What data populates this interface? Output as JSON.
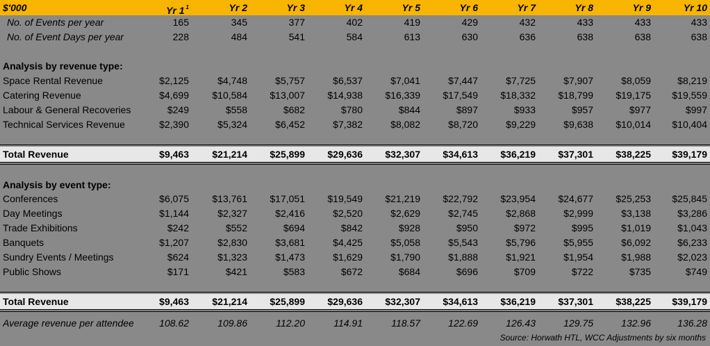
{
  "header": {
    "unit": "$'000",
    "years": [
      "Yr 1",
      "Yr 2",
      "Yr 3",
      "Yr 4",
      "Yr 5",
      "Yr 6",
      "Yr 7",
      "Yr 8",
      "Yr 9",
      "Yr 10"
    ],
    "yr1_footnote": "1"
  },
  "events": [
    {
      "label": "No. of  Events per year",
      "values": [
        "165",
        "345",
        "377",
        "402",
        "419",
        "429",
        "432",
        "433",
        "433",
        "433"
      ]
    },
    {
      "label": "No. of Event Days per year",
      "values": [
        "228",
        "484",
        "541",
        "584",
        "613",
        "630",
        "636",
        "638",
        "638",
        "638"
      ]
    }
  ],
  "revenue_section": {
    "title": "Analysis by revenue type:",
    "rows": [
      {
        "label": "Space Rental Revenue",
        "values": [
          "$2,125",
          "$4,748",
          "$5,757",
          "$6,537",
          "$7,041",
          "$7,447",
          "$7,725",
          "$7,907",
          "$8,059",
          "$8,219"
        ]
      },
      {
        "label": "Catering Revenue",
        "values": [
          "$4,699",
          "$10,584",
          "$13,007",
          "$14,938",
          "$16,339",
          "$17,549",
          "$18,332",
          "$18,799",
          "$19,175",
          "$19,559"
        ]
      },
      {
        "label": "Labour & General Recoveries",
        "values": [
          "$249",
          "$558",
          "$682",
          "$780",
          "$844",
          "$897",
          "$933",
          "$957",
          "$977",
          "$997"
        ]
      },
      {
        "label": "Technical Services Revenue",
        "values": [
          "$2,390",
          "$5,324",
          "$6,452",
          "$7,382",
          "$8,082",
          "$8,720",
          "$9,229",
          "$9,638",
          "$10,014",
          "$10,404"
        ]
      }
    ],
    "total": {
      "label": "Total Revenue",
      "values": [
        "$9,463",
        "$21,214",
        "$25,899",
        "$29,636",
        "$32,307",
        "$34,613",
        "$36,219",
        "$37,301",
        "$38,225",
        "$39,179"
      ]
    }
  },
  "event_section": {
    "title": "Analysis by event type:",
    "rows": [
      {
        "label": "Conferences",
        "values": [
          "$6,075",
          "$13,761",
          "$17,051",
          "$19,549",
          "$21,219",
          "$22,792",
          "$23,954",
          "$24,677",
          "$25,253",
          "$25,845"
        ]
      },
      {
        "label": "Day Meetings",
        "values": [
          "$1,144",
          "$2,327",
          "$2,416",
          "$2,520",
          "$2,629",
          "$2,745",
          "$2,868",
          "$2,999",
          "$3,138",
          "$3,286"
        ]
      },
      {
        "label": "Trade Exhibitions",
        "values": [
          "$242",
          "$552",
          "$694",
          "$842",
          "$928",
          "$950",
          "$972",
          "$995",
          "$1,019",
          "$1,043"
        ]
      },
      {
        "label": "Banquets",
        "values": [
          "$1,207",
          "$2,830",
          "$3,681",
          "$4,425",
          "$5,058",
          "$5,543",
          "$5,796",
          "$5,955",
          "$6,092",
          "$6,233"
        ]
      },
      {
        "label": "Sundry Events / Meetings",
        "values": [
          "$624",
          "$1,323",
          "$1,473",
          "$1,629",
          "$1,790",
          "$1,888",
          "$1,921",
          "$1,954",
          "$1,988",
          "$2,023"
        ]
      },
      {
        "label": "Public Shows",
        "values": [
          "$171",
          "$421",
          "$583",
          "$672",
          "$684",
          "$696",
          "$709",
          "$722",
          "$735",
          "$749"
        ]
      }
    ],
    "total": {
      "label": "Total Revenue",
      "values": [
        "$9,463",
        "$21,214",
        "$25,899",
        "$29,636",
        "$32,307",
        "$34,613",
        "$36,219",
        "$37,301",
        "$38,225",
        "$39,179"
      ]
    }
  },
  "average": {
    "label": "Average revenue per attendee",
    "values": [
      "108.62",
      "109.86",
      "112.20",
      "114.91",
      "118.57",
      "122.69",
      "126.43",
      "129.75",
      "132.96",
      "136.28"
    ]
  },
  "source": "Source: Horwath HTL, WCC Adjustments by six months",
  "colors": {
    "header": "#F7B500",
    "background": "#898989",
    "total_band": "#E7E7E7"
  }
}
